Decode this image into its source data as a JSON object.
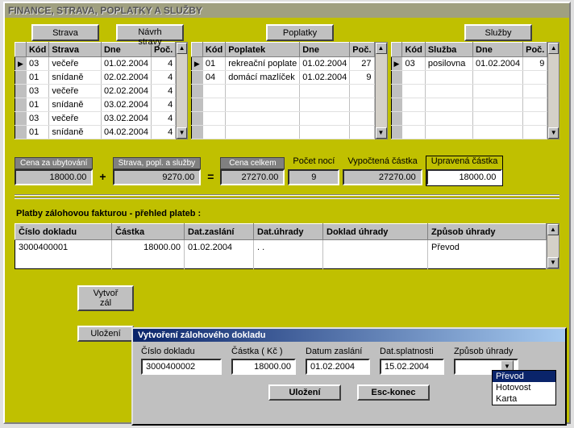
{
  "title": "FINANCE, STRAVA, POPLATKY A SLUŽBY",
  "topButtons": {
    "strava": "Strava",
    "navrh": "Návrh stravy",
    "poplatky": "Poplatky",
    "sluzby": "Služby"
  },
  "stravaGrid": {
    "headers": {
      "kod": "Kód",
      "strava": "Strava",
      "dne": "Dne",
      "poc": "Poč."
    },
    "rows": [
      {
        "kod": "03",
        "strava": "večeře",
        "dne": "01.02.2004",
        "poc": "4"
      },
      {
        "kod": "01",
        "strava": "snídaně",
        "dne": "02.02.2004",
        "poc": "4"
      },
      {
        "kod": "03",
        "strava": "večeře",
        "dne": "02.02.2004",
        "poc": "4"
      },
      {
        "kod": "01",
        "strava": "snídaně",
        "dne": "03.02.2004",
        "poc": "4"
      },
      {
        "kod": "03",
        "strava": "večeře",
        "dne": "03.02.2004",
        "poc": "4"
      },
      {
        "kod": "01",
        "strava": "snídaně",
        "dne": "04.02.2004",
        "poc": "4"
      }
    ]
  },
  "poplatkyGrid": {
    "headers": {
      "kod": "Kód",
      "poplatek": "Poplatek",
      "dne": "Dne",
      "poc": "Poč."
    },
    "rows": [
      {
        "kod": "01",
        "poplatek": "rekreační poplate",
        "dne": "01.02.2004",
        "poc": "27"
      },
      {
        "kod": "04",
        "poplatek": "domácí mazlíček",
        "dne": "01.02.2004",
        "poc": "9"
      }
    ]
  },
  "sluzbyGrid": {
    "headers": {
      "kod": "Kód",
      "sluzba": "Služba",
      "dne": "Dne",
      "poc": "Poč."
    },
    "rows": [
      {
        "kod": "03",
        "sluzba": "posilovna",
        "dne": "01.02.2004",
        "poc": "9"
      }
    ]
  },
  "totals": {
    "labels": {
      "ubyt": "Cena za ubytování",
      "sps": "Strava, popl. a služby",
      "celkem": "Cena celkem",
      "noci": "Počet nocí",
      "vypoc": "Vypočtená částka",
      "uprav": "Upravená částka"
    },
    "ubyt": "18000.00",
    "sps": "9270.00",
    "celkem": "27270.00",
    "noci": "9",
    "vypoc": "27270.00",
    "uprav": "18000.00"
  },
  "paymentsHeader": "Platby zálohovou fakturou - přehled plateb :",
  "payGrid": {
    "headers": {
      "cislo": "Číslo dokladu",
      "castka": "Částka",
      "zaslani": "Dat.zaslání",
      "uhrady": "Dat.úhrady",
      "doklad": "Doklad úhrady",
      "zpusob": "Způsob úhrady"
    },
    "rows": [
      {
        "cislo": "3000400001",
        "castka": "18000.00",
        "zaslani": "01.02.2004",
        "uhrady": ".  .",
        "doklad": "",
        "zpusob": "Převod"
      }
    ]
  },
  "bottomButtons": {
    "vytvor": "Vytvoř zál",
    "ulozeni": "Uložení"
  },
  "dialog": {
    "title": "Vytvoření zálohového dokladu",
    "labels": {
      "cislo": "Číslo dokladu",
      "castka": "Částka ( Kč )",
      "datum": "Datum zaslání",
      "splat": "Dat.splatnosti",
      "zpusob": "Způsob úhrady"
    },
    "values": {
      "cislo": "3000400002",
      "castka": "18000.00",
      "datum": "01.02.2004",
      "splat": "15.02.2004",
      "zpusob": "Převod"
    },
    "options": [
      "Převod",
      "Hotovost",
      "Karta"
    ],
    "buttons": {
      "save": "Uložení",
      "esc": "Esc-konec"
    }
  },
  "ops": {
    "plus": "+",
    "eq": "="
  }
}
